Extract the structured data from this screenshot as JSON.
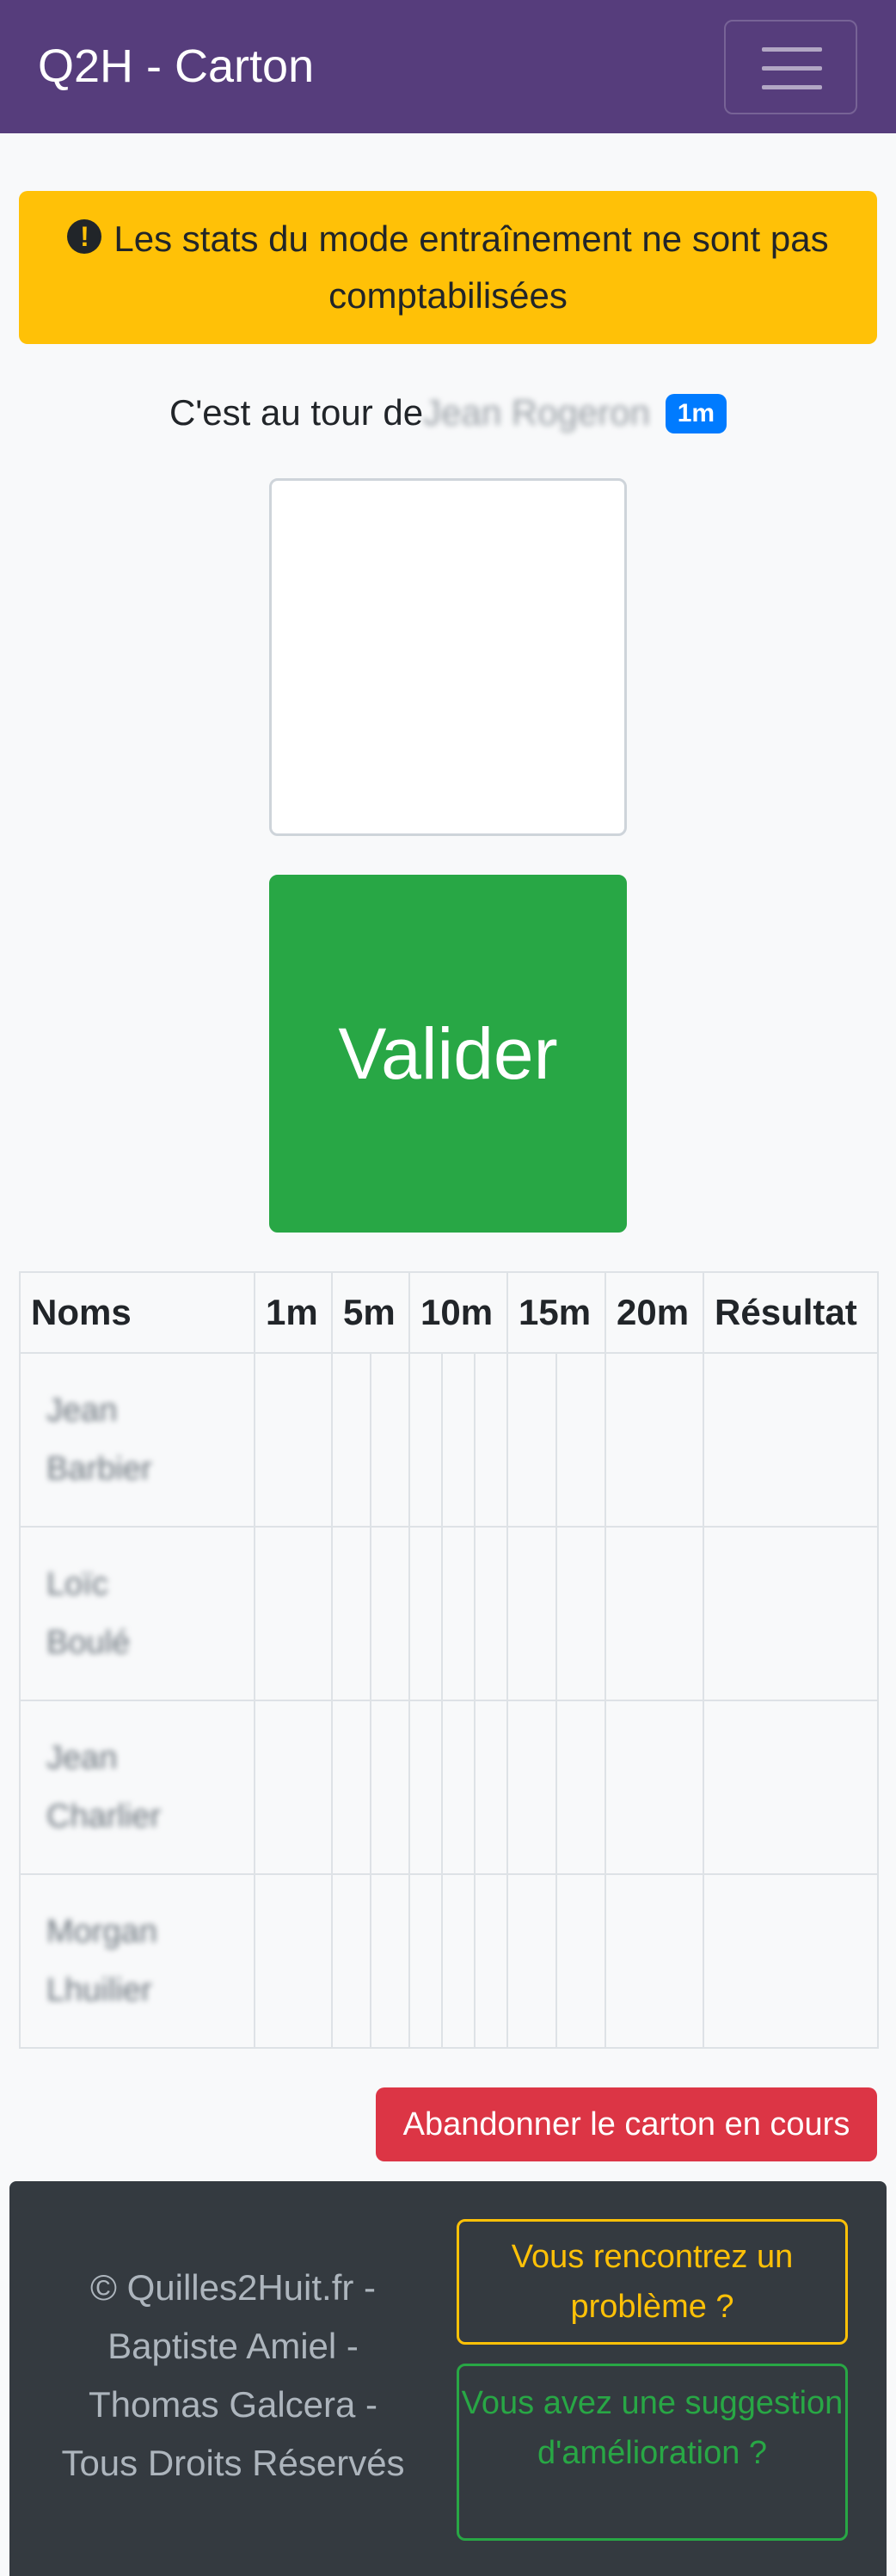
{
  "navbar": {
    "brand": "Q2H - Carton",
    "menu_icon": "hamburger-icon"
  },
  "alert": {
    "icon": "exclamation-circle-icon",
    "icon_glyph": "!",
    "text": "Les stats du mode entraînement ne sont pas comptabilisées"
  },
  "turn": {
    "prefix": "C'est au tour de",
    "player_name": "Jean Rogeron",
    "distance_badge": "1m"
  },
  "validate_button": "Valider",
  "table": {
    "headers": [
      "Noms",
      "1m",
      "5m",
      "10m",
      "15m",
      "20m",
      "Résultat"
    ],
    "players": [
      {
        "first": "Jean",
        "last": "Barbier"
      },
      {
        "first": "Loïc",
        "last": "Boulé"
      },
      {
        "first": "Jean",
        "last": "Charlier"
      },
      {
        "first": "Morgan",
        "last": "Lhuilier"
      }
    ]
  },
  "abandon_button": "Abandonner le carton en cours",
  "footer": {
    "copyright_lines": [
      "© Quilles2Huit.fr -",
      "Baptiste Amiel -",
      "Thomas Galcera -",
      "Tous Droits Réservés"
    ],
    "problem_button": "Vous rencontrez un problème ?",
    "suggestion_button": "Vous avez une suggestion d'amélioration ?"
  },
  "colors": {
    "navbar": "#563d7c",
    "warning": "#ffc107",
    "success": "#28a745",
    "danger": "#dc3545",
    "primary": "#007bff",
    "footer": "#343a40"
  }
}
